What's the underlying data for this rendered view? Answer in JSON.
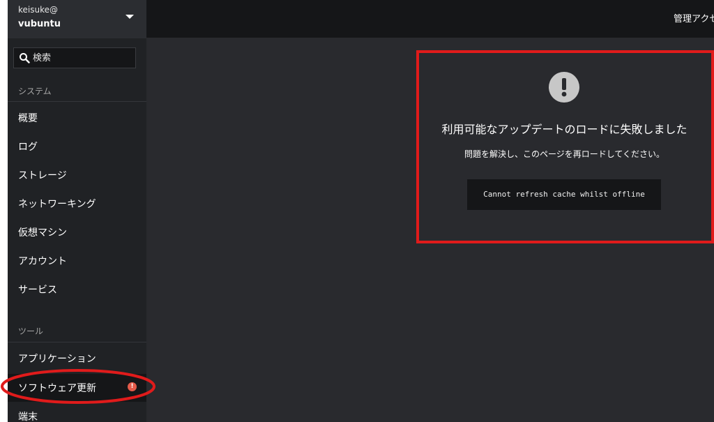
{
  "host": {
    "user": "keisuke@",
    "name": "vubuntu"
  },
  "search": {
    "placeholder": "検索"
  },
  "sidebar": {
    "system_heading": "システム",
    "system_items": [
      {
        "label": "概要"
      },
      {
        "label": "ログ"
      },
      {
        "label": "ストレージ"
      },
      {
        "label": "ネットワーキング"
      },
      {
        "label": "仮想マシン"
      },
      {
        "label": "アカウント"
      },
      {
        "label": "サービス"
      }
    ],
    "tools_heading": "ツール",
    "tools_items": [
      {
        "label": "アプリケーション"
      },
      {
        "label": "ソフトウェア更新",
        "active": true,
        "alert": "!"
      },
      {
        "label": "端末"
      }
    ]
  },
  "topbar": {
    "admin_access": "管理アクセス"
  },
  "error": {
    "icon": "exclamation-circle-icon",
    "title": "利用可能なアップデートのロードに失敗しました",
    "description": "問題を解決し、このページを再ロードしてください。",
    "code": "Cannot refresh cache whilst offline"
  },
  "colors": {
    "annotation": "#e01b1b",
    "sidebar_bg": "#202225",
    "main_bg": "#292a2e",
    "alert": "#e45b4a"
  }
}
